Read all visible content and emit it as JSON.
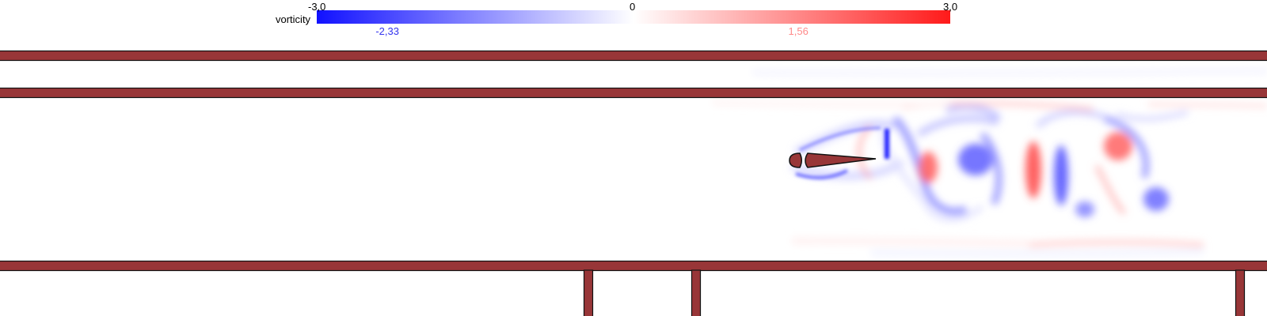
{
  "colorbar": {
    "label": "vorticity",
    "min_label": "-3,0",
    "zero_label": "0",
    "max_label": "3,0",
    "min": -3.0,
    "max": 3.0,
    "color_negative": "#1111ff",
    "color_zero": "#ffffff",
    "color_positive": "#ff1a1a",
    "current_min_label": "-2,33",
    "current_max_label": "1,56",
    "current_min": -2.33,
    "current_max": 1.56,
    "current_min_color": "#3333ee",
    "current_max_color": "#ff8a8a"
  },
  "scene": {
    "wall_color": "#983638",
    "outline_color": "#111111",
    "background": "#ffffff"
  }
}
